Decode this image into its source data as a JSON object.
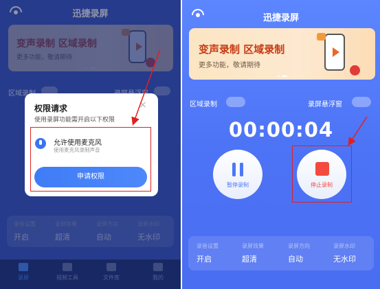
{
  "app": {
    "title": "迅捷录屏"
  },
  "banner": {
    "headline": "变声录制  区域录制",
    "subline": "更多功能，敬请期待"
  },
  "toggles": {
    "region_record": "区域录制",
    "float_window": "录屏悬浮窗"
  },
  "dialog": {
    "title": "权限请求",
    "close": "×",
    "subtitle": "使用录屏功能需开启以下权限",
    "permission_title": "允许使用麦克风",
    "permission_desc": "使用麦克风录制声音",
    "apply_button": "申请权限"
  },
  "timer": "00:00:04",
  "controls": {
    "pause_label": "暂停录制",
    "stop_label": "停止录制"
  },
  "settings": [
    {
      "label": "录音设置",
      "value": "开启"
    },
    {
      "label": "录屏效果",
      "value": "超清"
    },
    {
      "label": "录屏方向",
      "value": "自动"
    },
    {
      "label": "录屏水印",
      "value": "无水印"
    }
  ],
  "tabs": [
    {
      "label": "录屏"
    },
    {
      "label": "视频工具"
    },
    {
      "label": "文件库"
    },
    {
      "label": "我的"
    }
  ],
  "colors": {
    "accent": "#3b74f3",
    "stop": "#f24a40",
    "highlight": "#e02020"
  }
}
